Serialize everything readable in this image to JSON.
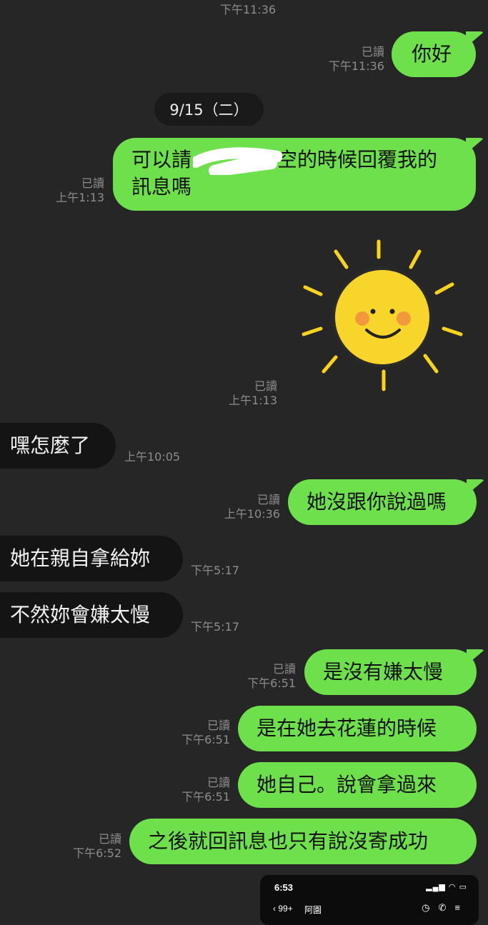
{
  "chat": {
    "top_time": "下午11:36",
    "messages": [
      {
        "id": "m1",
        "dir": "out",
        "text": "你好",
        "read": "已讀",
        "time": "下午11:36"
      },
      {
        "id": "m2",
        "dir": "out",
        "lines": [
          "可以請",
          "空的時候回覆我的",
          "訊息嗎"
        ],
        "read": "已讀",
        "time": "上午1:13"
      },
      {
        "id": "m3",
        "dir": "out",
        "sticker": "sun-sticker",
        "read": "已讀",
        "time": "上午1:13"
      },
      {
        "id": "m4",
        "dir": "in",
        "text": "嘿怎麼了",
        "time": "上午10:05"
      },
      {
        "id": "m5",
        "dir": "out",
        "text": "她沒跟你說過嗎",
        "read": "已讀",
        "time": "上午10:36"
      },
      {
        "id": "m6",
        "dir": "in",
        "text": "她在親自拿給妳",
        "time": "下午5:17"
      },
      {
        "id": "m7",
        "dir": "in",
        "text": "不然妳會嫌太慢",
        "time": "下午5:17"
      },
      {
        "id": "m8",
        "dir": "out",
        "text": "是沒有嫌太慢",
        "read": "已讀",
        "time": "下午6:51"
      },
      {
        "id": "m9",
        "dir": "out",
        "text": "是在她去花蓮的時候",
        "read": "已讀",
        "time": "下午6:51"
      },
      {
        "id": "m10",
        "dir": "out",
        "text": "她自己。說會拿過來",
        "read": "已讀",
        "time": "下午6:51"
      },
      {
        "id": "m11",
        "dir": "out",
        "text": "之後就回訊息也只有說沒寄成功",
        "read": "已讀",
        "time": "下午6:52"
      }
    ],
    "date_separator": "9/15（二）"
  },
  "phone_overlay": {
    "clock": "6:53",
    "back_count": "99+",
    "contact_name": "阿園",
    "back_icon": "chevron-left-icon",
    "status_icons": [
      "signal-icon",
      "wifi-icon",
      "battery-icon"
    ],
    "action_icons": [
      "clock-icon",
      "phone-icon",
      "menu-icon"
    ]
  },
  "colors": {
    "background": "#262626",
    "outgoing_bubble": "#6ee04c",
    "incoming_bubble": "#141414",
    "meta_text": "#8c8c8c"
  }
}
